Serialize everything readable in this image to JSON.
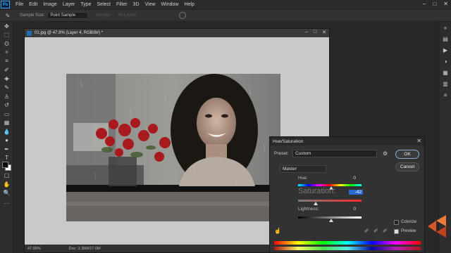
{
  "app": {
    "logo": "Ps",
    "menus": [
      "File",
      "Edit",
      "Image",
      "Layer",
      "Type",
      "Select",
      "Filter",
      "3D",
      "View",
      "Window",
      "Help"
    ]
  },
  "options_bar": {
    "sample_size_label": "Sample Size:",
    "sample_size_value": "Point Sample",
    "sample_label": "Sample:",
    "all_layers": "All Layers"
  },
  "document": {
    "tab_title": "01.jpg @ 47.9% (Layer 4, RGB/8#) *",
    "zoom": "47.95%",
    "doc_info": "Doc: 3.38M/27.0M"
  },
  "dialog": {
    "title": "Hue/Saturation",
    "preset_label": "Preset:",
    "preset_value": "Custom",
    "ok_label": "OK",
    "cancel_label": "Cancel",
    "channel": "Master",
    "hue_label": "Hue:",
    "hue_value": "0",
    "saturation_label": "Saturation:",
    "saturation_value": "-42",
    "lightness_label": "Lightness:",
    "lightness_value": "0",
    "colorize_label": "Colorize",
    "colorize_checked": false,
    "preview_label": "Preview",
    "preview_checked": true
  },
  "colors": {
    "accent": "#2b6ad0",
    "ps_blue": "#31a8ff"
  }
}
